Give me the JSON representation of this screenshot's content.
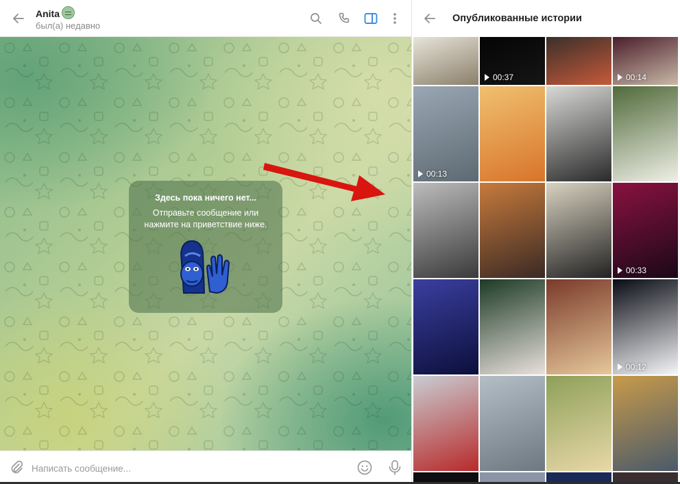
{
  "chat": {
    "header": {
      "name": "Anita",
      "status": "был(а) недавно"
    },
    "empty_state": {
      "title": "Здесь пока ничего нет...",
      "text": "Отправьте сообщение или нажмите на приветствие ниже."
    },
    "composer": {
      "placeholder": "Написать сообщение..."
    }
  },
  "stories": {
    "title": "Опубликованные истории",
    "tiles": [
      {
        "kind": "photo",
        "badge": "",
        "c1": "#e8e4da",
        "c2": "#8a7f6a"
      },
      {
        "kind": "video",
        "badge": "00:37",
        "c1": "#050505",
        "c2": "#151515"
      },
      {
        "kind": "photo",
        "badge": "",
        "c1": "#3b2f2a",
        "c2": "#c65a3a"
      },
      {
        "kind": "video",
        "badge": "00:14",
        "c1": "#4b1e2a",
        "c2": "#c8b8a8"
      },
      {
        "kind": "video",
        "badge": "00:13",
        "c1": "#9aa7b4",
        "c2": "#5d6a72"
      },
      {
        "kind": "photo",
        "badge": "",
        "c1": "#f0c070",
        "c2": "#d8742a"
      },
      {
        "kind": "photo",
        "badge": "",
        "c1": "#d8d9d6",
        "c2": "#2a2a2a"
      },
      {
        "kind": "photo",
        "badge": "",
        "c1": "#506a3a",
        "c2": "#efefe6"
      },
      {
        "kind": "photo",
        "badge": "",
        "c1": "#bcbcbc",
        "c2": "#3a3a3a"
      },
      {
        "kind": "photo",
        "badge": "",
        "c1": "#c77a3c",
        "c2": "#3a2a24"
      },
      {
        "kind": "photo",
        "badge": "",
        "c1": "#d8d2c0",
        "c2": "#222222"
      },
      {
        "kind": "video",
        "badge": "00:33",
        "c1": "#8a1240",
        "c2": "#1a0818"
      },
      {
        "kind": "photo",
        "badge": "",
        "c1": "#3b3fa0",
        "c2": "#0c0f3a"
      },
      {
        "kind": "photo",
        "badge": "",
        "c1": "#1c3a24",
        "c2": "#e8e0dc"
      },
      {
        "kind": "photo",
        "badge": "",
        "c1": "#7a3a2a",
        "c2": "#e6c79a"
      },
      {
        "kind": "video",
        "badge": "00:12",
        "c1": "#0a0c14",
        "c2": "#f4f6f8"
      },
      {
        "kind": "photo",
        "badge": "",
        "c1": "#c8cdd2",
        "c2": "#b82a2a"
      },
      {
        "kind": "photo",
        "badge": "",
        "c1": "#b4bec6",
        "c2": "#6e7880"
      },
      {
        "kind": "photo",
        "badge": "",
        "c1": "#8ea05a",
        "c2": "#e8d8a8"
      },
      {
        "kind": "photo",
        "badge": "",
        "c1": "#c89a4a",
        "c2": "#4a5a6a"
      }
    ]
  }
}
